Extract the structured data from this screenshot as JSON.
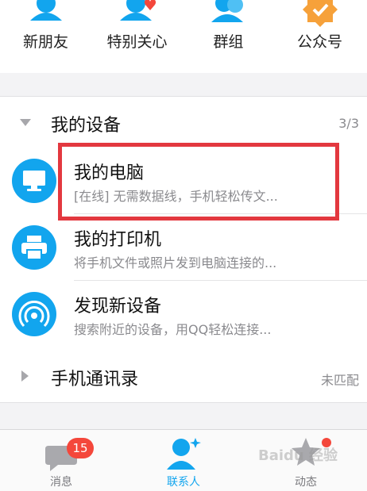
{
  "quick_nav": [
    {
      "label": "新朋友",
      "icon": "new-friend-icon"
    },
    {
      "label": "特别关心",
      "icon": "special-care-heart-icon"
    },
    {
      "label": "群组",
      "icon": "group-icon"
    },
    {
      "label": "公众号",
      "icon": "public-account-icon"
    }
  ],
  "devices_group": {
    "title": "我的设备",
    "count": "3/3",
    "items": [
      {
        "title": "我的电脑",
        "subtitle": "[在线] 无需数据线，手机轻松传文...",
        "icon": "computer-icon"
      },
      {
        "title": "我的打印机",
        "subtitle": "将手机文件或照片发到电脑连接的...",
        "icon": "printer-icon"
      },
      {
        "title": "发现新设备",
        "subtitle": "搜索附近的设备，用QQ轻松连接...",
        "icon": "radar-icon"
      }
    ]
  },
  "contacts_group": {
    "title": "手机通讯录",
    "status": "未匹配"
  },
  "tabbar": {
    "messages": {
      "label": "消息",
      "badge": "15"
    },
    "contacts": {
      "label": "联系人"
    },
    "dynamics": {
      "label": "动态"
    }
  },
  "watermark": "Baidu 经验",
  "colors": {
    "accent": "#12a5ee",
    "badge": "#f4473b",
    "highlight": "#e3383f"
  }
}
